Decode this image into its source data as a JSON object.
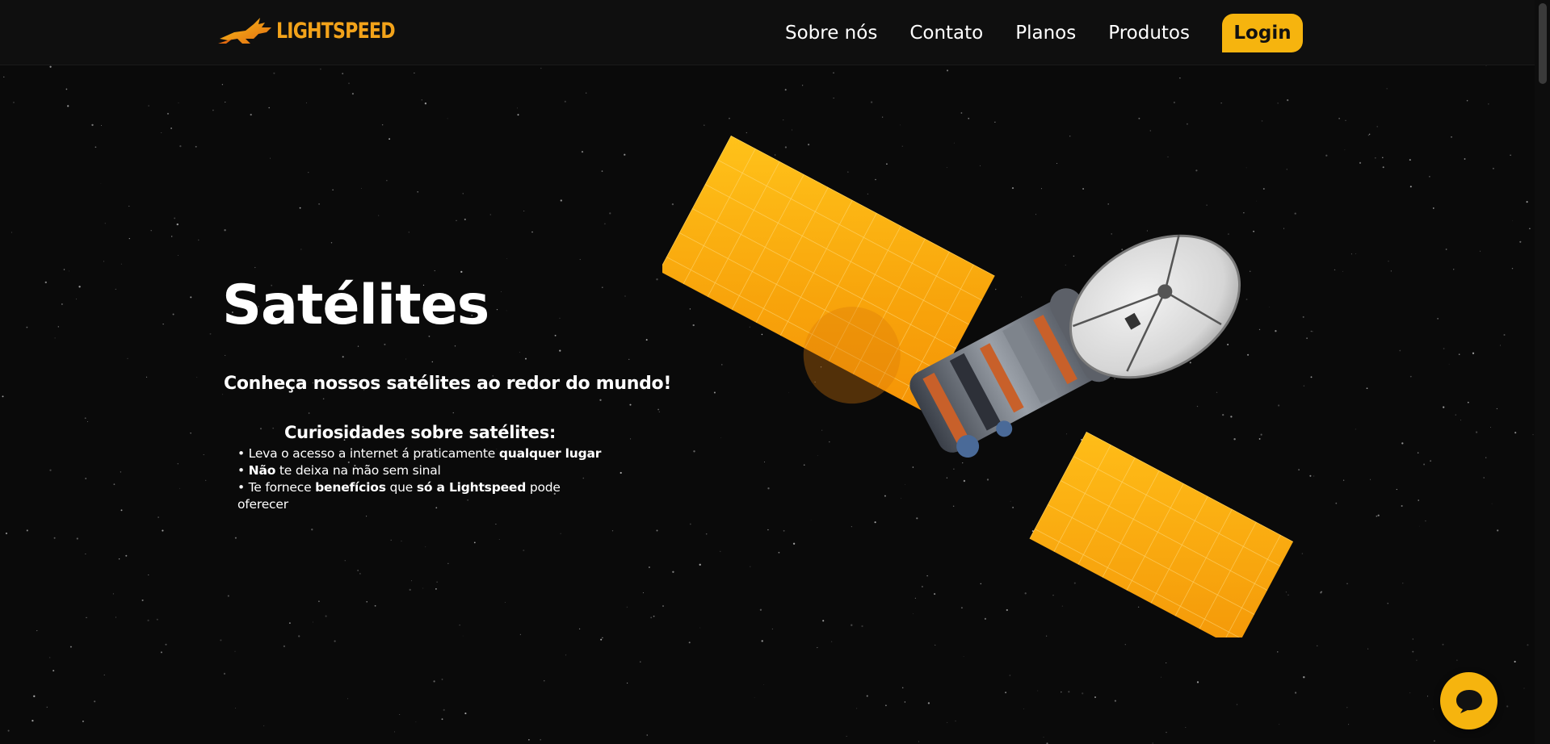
{
  "brand": {
    "name": "LIGHTSPEED",
    "color": "#f3a31a"
  },
  "nav": {
    "items": [
      "Sobre nós",
      "Contato",
      "Planos",
      "Produtos"
    ],
    "login_label": "Login",
    "accent": "#f6b40e"
  },
  "hero": {
    "title": "Satélites",
    "subtitle": "Conheça nossos satélites ao redor do mundo!"
  },
  "facts": {
    "title": "Curiosidades sobre satélites:",
    "items": [
      [
        {
          "text": "Leva o acesso a internet á praticamente "
        },
        {
          "text": "qualquer lugar",
          "bold": true
        }
      ],
      [
        {
          "text": "Não",
          "bold": true
        },
        {
          "text": " te deixa na mão sem sinal"
        }
      ],
      [
        {
          "text": "Te fornece "
        },
        {
          "text": "benefícios",
          "bold": true
        },
        {
          "text": " que "
        },
        {
          "text": "só a Lightspeed",
          "bold": true
        },
        {
          "text": " pode oferecer"
        }
      ]
    ]
  },
  "icons": {
    "logo": "rabbit-logo-icon",
    "chat": "chat-bubble-icon",
    "image": "satellite-illustration"
  },
  "colors": {
    "background": "#0a0a0a",
    "panel": "#f7a90c"
  }
}
